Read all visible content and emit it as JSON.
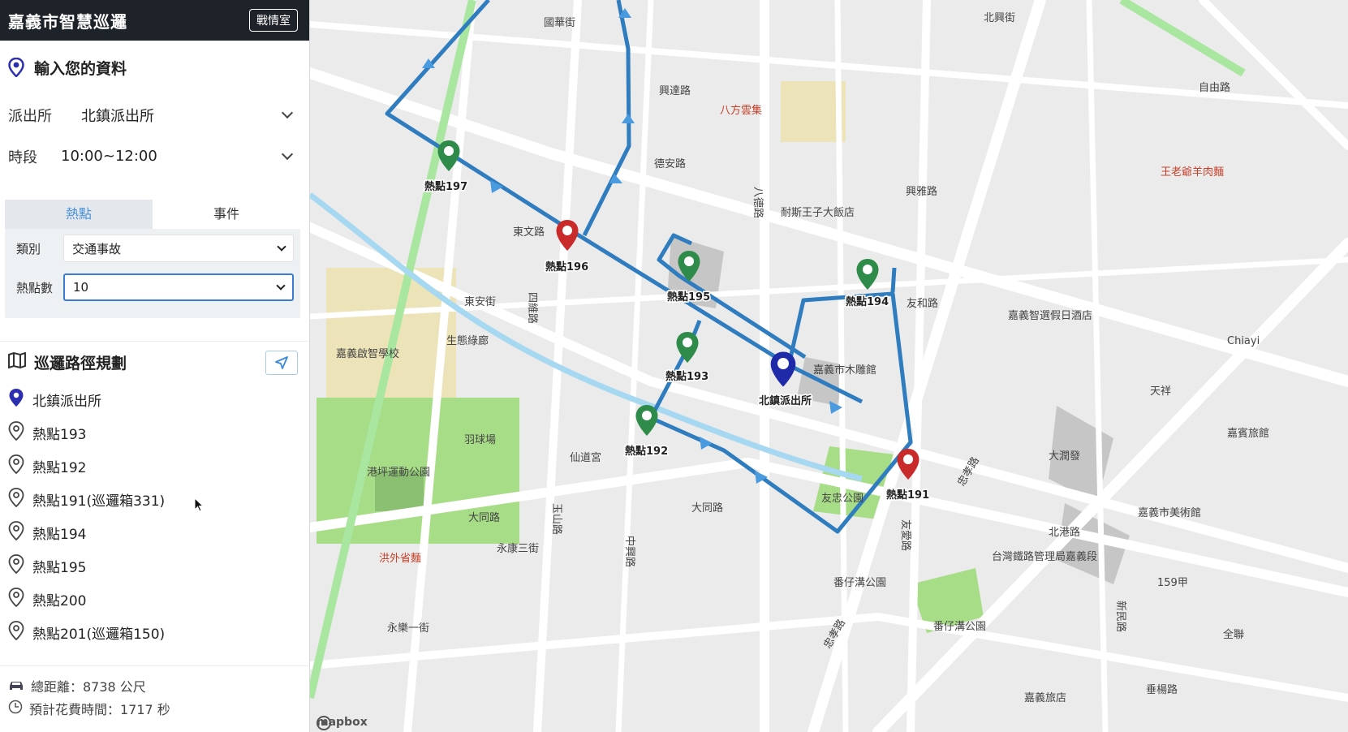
{
  "header": {
    "title": "嘉義市智慧巡邏",
    "war_room_label": "戰情室"
  },
  "info": {
    "heading": "輸入您的資料",
    "station_label": "派出所",
    "station_value": "北鎮派出所",
    "period_label": "時段",
    "period_value": "10:00~12:00"
  },
  "filter": {
    "tabs": [
      {
        "label": "熱點"
      },
      {
        "label": "事件"
      }
    ],
    "category_label": "類別",
    "category_value": "交通事故",
    "count_label": "熱點數",
    "count_value": "10"
  },
  "route": {
    "heading": "巡邏路徑規劃",
    "items": [
      {
        "label": "北鎮派出所",
        "kind": "station"
      },
      {
        "label": "熱點193",
        "kind": "hotspot"
      },
      {
        "label": "熱點192",
        "kind": "hotspot"
      },
      {
        "label": "熱點191(巡邏箱331)",
        "kind": "hotspot"
      },
      {
        "label": "熱點194",
        "kind": "hotspot"
      },
      {
        "label": "熱點195",
        "kind": "hotspot"
      },
      {
        "label": "熱點200",
        "kind": "hotspot"
      },
      {
        "label": "熱點201(巡邏箱150)",
        "kind": "hotspot"
      }
    ]
  },
  "summary": {
    "distance": "總距離：8738 公尺",
    "time": "預計花費時間：1717 秒"
  },
  "map": {
    "markers": {
      "h197": "熱點197",
      "h196": "熱點196",
      "h195": "熱點195",
      "h194": "熱點194",
      "h193": "熱點193",
      "h192": "熱點192",
      "h191": "熱點191",
      "station": "北鎮派出所"
    },
    "places": {
      "school": "嘉義啟智學校",
      "badminton": "羽球場",
      "sports_park": "港坪運動公園",
      "fangyuan": "八方雲集",
      "hotel": "耐斯王子大飯店",
      "museum": "嘉義市木雕館",
      "youzhong_park": "友忠公園",
      "shandao": "仙道宮",
      "hongshi": "洪外省麵",
      "fanzai_park": "番仔溝公園",
      "fanzai_park2": "番仔溝公園",
      "dongshi": "嘉義智選假日酒店",
      "art_museum": "嘉義市美術館",
      "rail_bureau": "台灣鐵路管理局嘉義段",
      "dachang": "大潤發",
      "guest": "嘉義旅店",
      "chiayi": "Chiayi",
      "quan": "全聯",
      "jifa": "嘉賓旅館",
      "wangjing": "王老爺羊肉麵",
      "shengtai": "生態綠廊"
    },
    "roads": {
      "zhongxiao": "忠孝路",
      "yonghe": "興達路",
      "dexing": "德安路",
      "xingya": "興雅路",
      "guofu": "國華街",
      "bade": "八德路",
      "wenhua": "東文路",
      "youai": "友愛路",
      "youhe": "友和路",
      "dongan": "東安街",
      "sijie": "四維路",
      "datong": "大同路",
      "dahe": "大同路",
      "yushan": "玉山路",
      "zhongxing": "中興路",
      "yonglo": "永樂一街",
      "yongkang": "永康三街",
      "minzu": "忠孝路",
      "beixin": "北港路",
      "minsheng": "新民路",
      "chuichang": "垂楊路",
      "beixing": "北興街",
      "ziyou": "自由路",
      "tianjin": "天祥",
      "highway": "159甲"
    },
    "logo": "mapbox"
  }
}
